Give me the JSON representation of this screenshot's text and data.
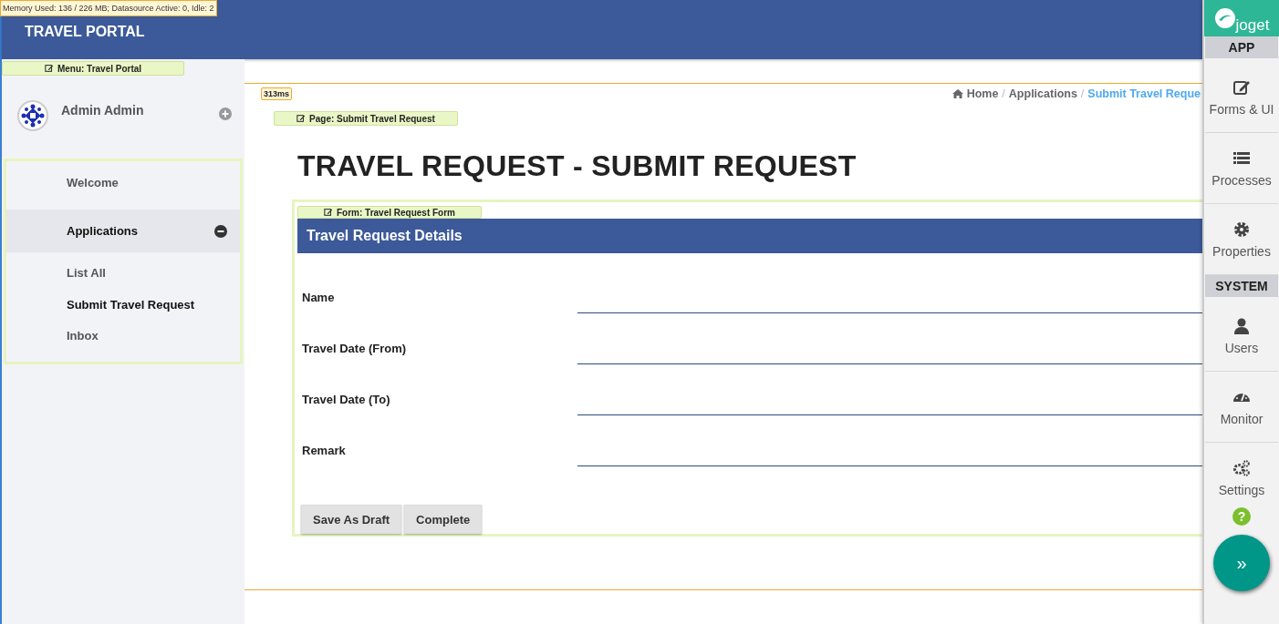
{
  "debug": {
    "memory": "Memory Used: 136 / 226 MB; Datasource Active: 0, Idle: 2",
    "timing": "313ms"
  },
  "header": {
    "title": "TRAVEL PORTAL"
  },
  "sidebar": {
    "menu_badge": "Menu: Travel Portal",
    "user": "Admin Admin",
    "items": [
      {
        "label": "Welcome",
        "expanded": false
      },
      {
        "label": "Applications",
        "expanded": true,
        "children": [
          {
            "label": "List All",
            "selected": false
          },
          {
            "label": "Submit Travel Request",
            "selected": true
          },
          {
            "label": "Inbox",
            "selected": false
          }
        ]
      }
    ]
  },
  "breadcrumb": [
    {
      "label": "Home",
      "current": false,
      "separator": "/"
    },
    {
      "label": "Applications",
      "current": false,
      "separator": "/"
    },
    {
      "label": "Submit Travel Reque",
      "current": true
    }
  ],
  "page_badge": "Page: Submit Travel Request",
  "page_title": "TRAVEL REQUEST - SUBMIT REQUEST",
  "form": {
    "badge": "Form: Travel Request Form",
    "section_title": "Travel Request Details",
    "fields": [
      {
        "label": "Name"
      },
      {
        "label": "Travel Date (From)"
      },
      {
        "label": "Travel Date (To)"
      },
      {
        "label": "Remark"
      }
    ],
    "buttons": [
      "Save As Draft",
      "Complete"
    ]
  },
  "panel": {
    "logo": "joget",
    "sections": [
      {
        "heading": "APP",
        "items": [
          {
            "label": "Forms & UI"
          },
          {
            "label": "Processes"
          },
          {
            "label": "Properties"
          }
        ]
      },
      {
        "heading": "SYSTEM",
        "items": [
          {
            "label": "Users"
          },
          {
            "label": "Monitor"
          },
          {
            "label": "Settings"
          }
        ]
      }
    ],
    "help": "?",
    "toggle": "»"
  }
}
